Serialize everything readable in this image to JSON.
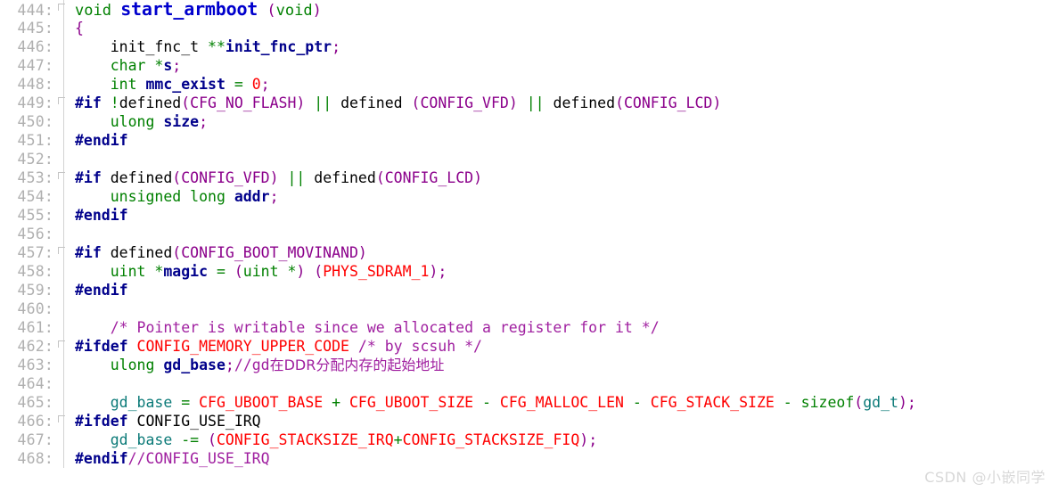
{
  "viewer": {
    "first_line": 444,
    "last_line": 468,
    "gutter_separator": ":",
    "background_color": "#ffffff",
    "gutter_color": "#b0b0b0"
  },
  "palette": {
    "keyword_green": "#008000",
    "preprocessor_navy": "#00008b",
    "identifier_navy": "#00008b",
    "macro_purple": "#8b008b",
    "constant_red": "#ff0000",
    "comment_purple": "#a020a0",
    "function_blue": "#0000cd",
    "variable_teal": "#0b7a78",
    "plain_black": "#000000"
  },
  "watermark": {
    "text": "CSDN @小嵌同学",
    "color": "#d8d8d8"
  },
  "lines": [
    {
      "number": "444",
      "fold": true,
      "tokens": [
        {
          "text": "void ",
          "cls": "t-keyword"
        },
        {
          "text": "start_armboot",
          "cls": "fn-name"
        },
        {
          "text": " ",
          "cls": "t-plain"
        },
        {
          "text": "(",
          "cls": "t-punct"
        },
        {
          "text": "void",
          "cls": "t-keyword"
        },
        {
          "text": ")",
          "cls": "t-punct"
        }
      ]
    },
    {
      "number": "445",
      "fold": false,
      "tokens": [
        {
          "text": "{",
          "cls": "t-brace"
        }
      ]
    },
    {
      "number": "446",
      "fold": false,
      "tokens": [
        {
          "text": "    init_fnc_t ",
          "cls": "t-plain"
        },
        {
          "text": "**",
          "cls": "t-op"
        },
        {
          "text": "init_fnc_ptr",
          "cls": "t-ident"
        },
        {
          "text": ";",
          "cls": "t-punct"
        }
      ]
    },
    {
      "number": "447",
      "fold": false,
      "tokens": [
        {
          "text": "    char ",
          "cls": "t-keyword"
        },
        {
          "text": "*",
          "cls": "t-op"
        },
        {
          "text": "s",
          "cls": "t-ident"
        },
        {
          "text": ";",
          "cls": "t-punct"
        }
      ]
    },
    {
      "number": "448",
      "fold": false,
      "tokens": [
        {
          "text": "    int ",
          "cls": "t-keyword"
        },
        {
          "text": "mmc_exist",
          "cls": "t-ident"
        },
        {
          "text": " ",
          "cls": "t-plain"
        },
        {
          "text": "=",
          "cls": "t-op"
        },
        {
          "text": " ",
          "cls": "t-plain"
        },
        {
          "text": "0",
          "cls": "t-const"
        },
        {
          "text": ";",
          "cls": "t-punct"
        }
      ]
    },
    {
      "number": "449",
      "fold": true,
      "tokens": [
        {
          "text": "#if",
          "cls": "t-pp"
        },
        {
          "text": " ",
          "cls": "t-plain"
        },
        {
          "text": "!",
          "cls": "t-op"
        },
        {
          "text": "defined",
          "cls": "t-plain"
        },
        {
          "text": "(",
          "cls": "t-punct"
        },
        {
          "text": "CFG_NO_FLASH",
          "cls": "t-macro"
        },
        {
          "text": ")",
          "cls": "t-punct"
        },
        {
          "text": " ",
          "cls": "t-plain"
        },
        {
          "text": "||",
          "cls": "t-op"
        },
        {
          "text": " defined ",
          "cls": "t-plain"
        },
        {
          "text": "(",
          "cls": "t-punct"
        },
        {
          "text": "CONFIG_VFD",
          "cls": "t-macro"
        },
        {
          "text": ")",
          "cls": "t-punct"
        },
        {
          "text": " ",
          "cls": "t-plain"
        },
        {
          "text": "||",
          "cls": "t-op"
        },
        {
          "text": " defined",
          "cls": "t-plain"
        },
        {
          "text": "(",
          "cls": "t-punct"
        },
        {
          "text": "CONFIG_LCD",
          "cls": "t-macro"
        },
        {
          "text": ")",
          "cls": "t-punct"
        }
      ]
    },
    {
      "number": "450",
      "fold": false,
      "tokens": [
        {
          "text": "    ulong ",
          "cls": "t-keyword"
        },
        {
          "text": "size",
          "cls": "t-ident"
        },
        {
          "text": ";",
          "cls": "t-punct"
        }
      ]
    },
    {
      "number": "451",
      "fold": false,
      "tokens": [
        {
          "text": "#endif",
          "cls": "t-pp"
        }
      ]
    },
    {
      "number": "452",
      "fold": false,
      "tokens": []
    },
    {
      "number": "453",
      "fold": true,
      "tokens": [
        {
          "text": "#if",
          "cls": "t-pp"
        },
        {
          "text": " defined",
          "cls": "t-plain"
        },
        {
          "text": "(",
          "cls": "t-punct"
        },
        {
          "text": "CONFIG_VFD",
          "cls": "t-macro"
        },
        {
          "text": ")",
          "cls": "t-punct"
        },
        {
          "text": " ",
          "cls": "t-plain"
        },
        {
          "text": "||",
          "cls": "t-op"
        },
        {
          "text": " defined",
          "cls": "t-plain"
        },
        {
          "text": "(",
          "cls": "t-punct"
        },
        {
          "text": "CONFIG_LCD",
          "cls": "t-macro"
        },
        {
          "text": ")",
          "cls": "t-punct"
        }
      ]
    },
    {
      "number": "454",
      "fold": false,
      "tokens": [
        {
          "text": "    unsigned long ",
          "cls": "t-keyword"
        },
        {
          "text": "addr",
          "cls": "t-ident"
        },
        {
          "text": ";",
          "cls": "t-punct"
        }
      ]
    },
    {
      "number": "455",
      "fold": false,
      "tokens": [
        {
          "text": "#endif",
          "cls": "t-pp"
        }
      ]
    },
    {
      "number": "456",
      "fold": false,
      "tokens": []
    },
    {
      "number": "457",
      "fold": true,
      "tokens": [
        {
          "text": "#if",
          "cls": "t-pp"
        },
        {
          "text": " defined",
          "cls": "t-plain"
        },
        {
          "text": "(",
          "cls": "t-punct"
        },
        {
          "text": "CONFIG_BOOT_MOVINAND",
          "cls": "t-macro"
        },
        {
          "text": ")",
          "cls": "t-punct"
        }
      ]
    },
    {
      "number": "458",
      "fold": false,
      "tokens": [
        {
          "text": "    uint ",
          "cls": "t-keyword"
        },
        {
          "text": "*",
          "cls": "t-op"
        },
        {
          "text": "magic",
          "cls": "t-ident"
        },
        {
          "text": " ",
          "cls": "t-plain"
        },
        {
          "text": "=",
          "cls": "t-op"
        },
        {
          "text": " ",
          "cls": "t-plain"
        },
        {
          "text": "(",
          "cls": "t-punct"
        },
        {
          "text": "uint ",
          "cls": "t-keyword"
        },
        {
          "text": "*",
          "cls": "t-op"
        },
        {
          "text": ")",
          "cls": "t-punct"
        },
        {
          "text": " ",
          "cls": "t-plain"
        },
        {
          "text": "(",
          "cls": "t-punct"
        },
        {
          "text": "PHYS_SDRAM_1",
          "cls": "t-const"
        },
        {
          "text": ")",
          "cls": "t-punct"
        },
        {
          "text": ";",
          "cls": "t-punct"
        }
      ]
    },
    {
      "number": "459",
      "fold": false,
      "tokens": [
        {
          "text": "#endif",
          "cls": "t-pp"
        }
      ]
    },
    {
      "number": "460",
      "fold": false,
      "tokens": []
    },
    {
      "number": "461",
      "fold": false,
      "tokens": [
        {
          "text": "    /* Pointer is writable since we allocated a register for it */",
          "cls": "t-comment"
        }
      ]
    },
    {
      "number": "462",
      "fold": true,
      "tokens": [
        {
          "text": "#ifdef",
          "cls": "t-pp"
        },
        {
          "text": " ",
          "cls": "t-plain"
        },
        {
          "text": "CONFIG_MEMORY_UPPER_CODE",
          "cls": "t-const"
        },
        {
          "text": " ",
          "cls": "t-plain"
        },
        {
          "text": "/* by scsuh */",
          "cls": "t-comment"
        }
      ]
    },
    {
      "number": "463",
      "fold": false,
      "tokens": [
        {
          "text": "    ulong ",
          "cls": "t-keyword"
        },
        {
          "text": "gd_base",
          "cls": "t-ident"
        },
        {
          "text": ";",
          "cls": "t-punct"
        },
        {
          "text": "//gd",
          "cls": "t-comment"
        },
        {
          "text": "在DDR分配内存的起始地址",
          "cls": "t-comment cjk"
        }
      ]
    },
    {
      "number": "464",
      "fold": false,
      "tokens": []
    },
    {
      "number": "465",
      "fold": false,
      "tokens": [
        {
          "text": "    ",
          "cls": "t-plain"
        },
        {
          "text": "gd_base",
          "cls": "t-teal"
        },
        {
          "text": " ",
          "cls": "t-plain"
        },
        {
          "text": "=",
          "cls": "t-op"
        },
        {
          "text": " ",
          "cls": "t-plain"
        },
        {
          "text": "CFG_UBOOT_BASE",
          "cls": "t-const"
        },
        {
          "text": " ",
          "cls": "t-plain"
        },
        {
          "text": "+",
          "cls": "t-op"
        },
        {
          "text": " ",
          "cls": "t-plain"
        },
        {
          "text": "CFG_UBOOT_SIZE",
          "cls": "t-const"
        },
        {
          "text": " ",
          "cls": "t-plain"
        },
        {
          "text": "-",
          "cls": "t-op"
        },
        {
          "text": " ",
          "cls": "t-plain"
        },
        {
          "text": "CFG_MALLOC_LEN",
          "cls": "t-const"
        },
        {
          "text": " ",
          "cls": "t-plain"
        },
        {
          "text": "-",
          "cls": "t-op"
        },
        {
          "text": " ",
          "cls": "t-plain"
        },
        {
          "text": "CFG_STACK_SIZE",
          "cls": "t-const"
        },
        {
          "text": " ",
          "cls": "t-plain"
        },
        {
          "text": "-",
          "cls": "t-op"
        },
        {
          "text": " ",
          "cls": "t-plain"
        },
        {
          "text": "sizeof",
          "cls": "t-keyword"
        },
        {
          "text": "(",
          "cls": "t-punct"
        },
        {
          "text": "gd_t",
          "cls": "t-teal"
        },
        {
          "text": ")",
          "cls": "t-punct"
        },
        {
          "text": ";",
          "cls": "t-punct"
        }
      ]
    },
    {
      "number": "466",
      "fold": true,
      "tokens": [
        {
          "text": "#ifdef",
          "cls": "t-pp"
        },
        {
          "text": " CONFIG_USE_IRQ",
          "cls": "t-plain"
        }
      ]
    },
    {
      "number": "467",
      "fold": false,
      "tokens": [
        {
          "text": "    ",
          "cls": "t-plain"
        },
        {
          "text": "gd_base",
          "cls": "t-teal"
        },
        {
          "text": " ",
          "cls": "t-plain"
        },
        {
          "text": "-=",
          "cls": "t-op"
        },
        {
          "text": " ",
          "cls": "t-plain"
        },
        {
          "text": "(",
          "cls": "t-punct"
        },
        {
          "text": "CONFIG_STACKSIZE_IRQ",
          "cls": "t-const"
        },
        {
          "text": "+",
          "cls": "t-op"
        },
        {
          "text": "CONFIG_STACKSIZE_FIQ",
          "cls": "t-const"
        },
        {
          "text": ")",
          "cls": "t-punct"
        },
        {
          "text": ";",
          "cls": "t-punct"
        }
      ]
    },
    {
      "number": "468",
      "fold": false,
      "tokens": [
        {
          "text": "#endif",
          "cls": "t-pp"
        },
        {
          "text": "//CONFIG_USE_IRQ",
          "cls": "t-comment"
        }
      ]
    }
  ]
}
